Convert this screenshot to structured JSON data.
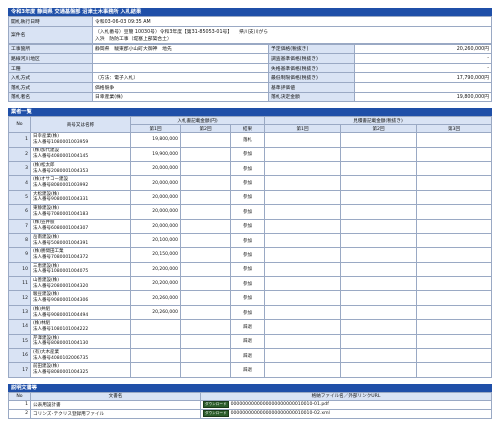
{
  "title": "令和3年度 静岡県 交通基盤部 沼津土木事務所 入札結果",
  "info": {
    "rows": [
      {
        "label": "開札執行日時",
        "value": "令和03-06-03 09:35 AM"
      },
      {
        "label": "案件名",
        "value1": "（入札番号）豆簡 10030号）令和3年度【第31-85053-01号】　　県川支川がら",
        "value2": "入浜　防防工事（堤塞上部築合土）"
      }
    ],
    "grid": [
      {
        "l1": "工事箇所",
        "v1": "静岡県　駿東郡小山町大御神　地先",
        "l2": "予定価格(税抜き)",
        "v2": "20,260,000円"
      },
      {
        "l1": "路線河川地区",
        "v1": "",
        "l2": "調査基準価格(税抜き)",
        "v2": "-"
      },
      {
        "l1": "工種",
        "v1": "",
        "l2": "失格基準価格(税抜き)",
        "v2": "-"
      },
      {
        "l1": "入札方式",
        "v1": "（方法：電子入札）",
        "l2": "最低制限価格(税抜き)",
        "v2": "17,790,000円"
      },
      {
        "l1": "落札方式",
        "v1": "価格競争",
        "l2": "基準評価値",
        "v2": ""
      },
      {
        "l1": "落札者名",
        "v1": "日幸産業(株)",
        "l2": "落札決定金額",
        "v2": "19,800,000円"
      }
    ]
  },
  "bidders_title": "業者一覧",
  "bid_headers": {
    "no": "No",
    "name": "商号又は名称",
    "group1": "入札書記載金額(円)",
    "group2": "見積書記載金額(税抜き)",
    "r1": "第1回",
    "r2": "第2回",
    "result": "結果",
    "s1": "第1回",
    "s2": "第2回",
    "s3": "第3回"
  },
  "bidders": [
    {
      "no": "1",
      "name": "日幸産業(株)",
      "reg": "法人番号1080001003959",
      "r1": "19,800,000",
      "r2": "",
      "result": "落札"
    },
    {
      "no": "2",
      "name": "(株)加代建設",
      "reg": "法人番号4080001004145",
      "r1": "19,900,000",
      "r2": "",
      "result": "参加"
    },
    {
      "no": "3",
      "name": "(株)松太郎",
      "reg": "法人番号2080001004353",
      "r1": "20,000,000",
      "r2": "",
      "result": "参加"
    },
    {
      "no": "4",
      "name": "(株)オサコー建設",
      "reg": "法人番号8080001003992",
      "r1": "20,000,000",
      "r2": "",
      "result": "参加"
    },
    {
      "no": "5",
      "name": "大松建設(株)",
      "reg": "法人番号9080001004331",
      "r1": "20,000,000",
      "r2": "",
      "result": "参加"
    },
    {
      "no": "6",
      "name": "東静建設(株)",
      "reg": "法人番号7080001004183",
      "r1": "20,000,000",
      "r2": "",
      "result": "参加"
    },
    {
      "no": "7",
      "name": "(株)笠井肢",
      "reg": "法人番号6080001004307",
      "r1": "20,000,000",
      "r2": "",
      "result": "参加"
    },
    {
      "no": "8",
      "name": "岳南建設(株)",
      "reg": "法人番号5080001004391",
      "r1": "20,100,000",
      "r2": "",
      "result": "参加"
    },
    {
      "no": "9",
      "name": "(株)勝間田工業",
      "reg": "法人番号7080001004372",
      "r1": "20,150,000",
      "r2": "",
      "result": "参加"
    },
    {
      "no": "10",
      "name": "三恵建設(株)",
      "reg": "法人番号1080001004075",
      "r1": "20,200,000",
      "r2": "",
      "result": "参加"
    },
    {
      "no": "11",
      "name": "山善建設(株)",
      "reg": "法人番号2080001004320",
      "r1": "20,200,000",
      "r2": "",
      "result": "参加"
    },
    {
      "no": "12",
      "name": "駿豆建設(株)",
      "reg": "法人番号9080001004306",
      "r1": "20,260,000",
      "r2": "",
      "result": "参加"
    },
    {
      "no": "13",
      "name": "(株)井組",
      "reg": "法人番号9080001004494",
      "r1": "20,260,000",
      "r2": "",
      "result": "参加"
    },
    {
      "no": "14",
      "name": "(株)林組",
      "reg": "法人番号1080101004222",
      "r1": "",
      "r2": "",
      "result": "辞退"
    },
    {
      "no": "15",
      "name": "芹澤建設(株)",
      "reg": "法人番号8080001004130",
      "r1": "",
      "r2": "",
      "result": "辞退"
    },
    {
      "no": "16",
      "name": "(有)大木産業",
      "reg": "法人番号4080102006735",
      "r1": "",
      "r2": "",
      "result": "辞退"
    },
    {
      "no": "17",
      "name": "前田建設(株)",
      "reg": "法人番号8080001004325",
      "r1": "",
      "r2": "",
      "result": "辞退"
    }
  ],
  "docs_title": "説明文書等",
  "doc_headers": {
    "no": "No",
    "name": "文書名",
    "file": "格納ファイル名／外部リンクURL"
  },
  "download_label": "ダウンロード",
  "docs": [
    {
      "no": "1",
      "name": "公表用設計書",
      "file": "0000000000000000000000010010-01.pdf"
    },
    {
      "no": "2",
      "name": "コリンズ･テクリス登録用ファイル",
      "file": "0000000000000000000000010010-02.xml"
    }
  ]
}
